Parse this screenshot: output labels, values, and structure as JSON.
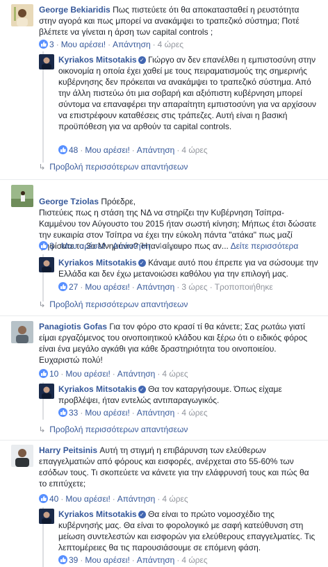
{
  "labels": {
    "like": "Μου αρέσει!",
    "reply": "Απάντηση",
    "see_more": "Δείτε περισσότερα",
    "edited": "Τροποποιήθηκε",
    "more_replies": "Προβολή περισσότερων απαντήσεων"
  },
  "comments": [
    {
      "author": "George Bekiaridis",
      "text": "Πως πιστεύετε ότι θα αποκατασταθεί η ρευστότητα στην αγορά και πως μπορεί να ανακάμψει το τραπεζικό σύστημα; Ποτέ βλέπετε να γίνεται η άρση των capital controls ;",
      "likes": "3",
      "time": "4 ώρες",
      "reply": {
        "author": "Kyriakos Mitsotakis",
        "text": "Γιώργο αν δεν επανέλθει η εμπιστοσύνη στην οικονομία η οποία έχει χαθεί με τους πειραματισμούς της σημερινής κυβέρνησης δεν πρόκειται να ανακάμψει το τραπεζικό σύστημα. Από την άλλη πιστεύω ότι μια σοβαρή και αξιόπιστη κυβέρνηση μπορεί σύντομα να επαναφέρει την απαραίτητη εμπιστοσύνη για να αρχίσουν να επιστρέφουν καταθέσεις στις τράπεζες. Αυτή είναι η βασική προϋπόθεση για να αρθούν τα capital controls.",
        "likes": "48",
        "time": "4 ώρες"
      }
    },
    {
      "author": "George Tziolas",
      "text": "Πρόεδρε,\nΠιστεύεις πως η στάση της ΝΔ να στηρίζει την Κυβέρνηση Τσίπρα-Καμμένου τον Αύγουστο του 2015 ήταν σωστή κίνηση; Μήπως έτσι δώσατε την ευκαιρία στον Τσίπρα να έχει την εύκολη πάντα \"ατάκα\" πως μαζί ψηφίσατε το 3ο Μνημόνιο? Ήταν σίγουρο πως αν...",
      "likes": "3",
      "time": "4 ώρες",
      "reply": {
        "author": "Kyriakos Mitsotakis",
        "text": "Κάναμε αυτό που έπρεπε για να σώσουμε την Ελλάδα και δεν έχω μετανοιώσει καθόλου για την επιλογή μας.",
        "likes": "27",
        "time": "3 ώρες"
      }
    },
    {
      "author": "Panagiotis Gofas",
      "text": "Για τον φόρο στο κρασί τί θα κάνετε; Σας ρωτάω γιατί είμαι εργαζόμενος του οινοποιητικού κλάδου και ξέρω ότι ο ειδικός φόρος είναι ένα μεγάλο αγκάθι για κάθε δραστηριότητα του οινοποιείου. Ευχαριστώ πολύ!",
      "likes": "10",
      "time": "4 ώρες",
      "reply": {
        "author": "Kyriakos Mitsotakis",
        "text": "Θα τον καταργήσουμε. Όπως είχαμε προβλέψει, ήταν εντελώς αντιπαραγωγικός.",
        "likes": "33",
        "time": "4 ώρες"
      }
    },
    {
      "author": "Harry Peitsinis",
      "text": "Αυτή τη στιγμή η επιβάρυνση των ελεύθερων επαγγελματιών από φόρους και εισφορές, ανέρχεται στο 55-60% των εσόδων τους. Τι σκοπεύετε να κάνετε για την ελάφρυνσή τους και πώς θα το επιτύχετε;",
      "likes": "40",
      "time": "4 ώρες",
      "reply": {
        "author": "Kyriakos Mitsotakis",
        "text": "Θα είναι το πρώτο νομοσχέδιο της κυβέρνησής μας. Θα είναι το φορολογικό με σαφή κατεύθυνση στη μείωση συντελεστών και εισφορών για ελεύθερους επαγγελματίες. Τις λεπτομέρειες θα τις παρουσιάσουμε σε επόμενη φάση.",
        "likes": "39",
        "time": "4 ώρες"
      }
    }
  ]
}
